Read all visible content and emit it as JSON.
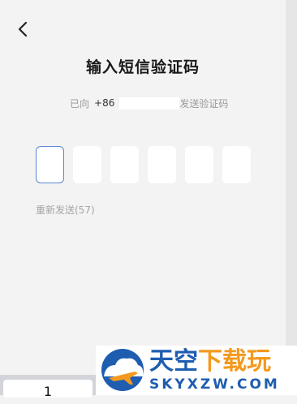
{
  "header": {
    "title": "输入短信验证码"
  },
  "sent_info": {
    "prefix": "已向",
    "country_code": "+86",
    "suffix": "发送验证码"
  },
  "otp": {
    "length": 6,
    "values": [
      "",
      "",
      "",
      "",
      "",
      ""
    ]
  },
  "resend": {
    "label": "重新发送(57)"
  },
  "keyboard": {
    "visible_key": "1"
  },
  "watermark": {
    "text_main": "天空",
    "text_accent": "下载玩",
    "domain": "SKYXZW.COM"
  },
  "colors": {
    "background": "#f3f3f3",
    "active_border": "#5a86d6",
    "muted_text": "#9a9a9a",
    "watermark_blue": "#1e5db0",
    "watermark_orange": "#f39a1e"
  }
}
